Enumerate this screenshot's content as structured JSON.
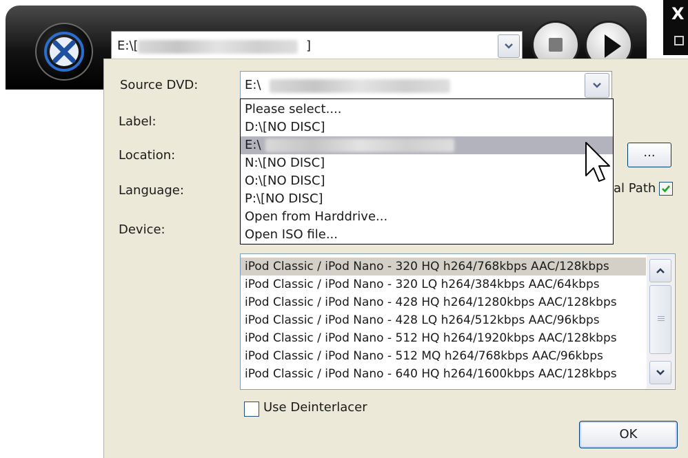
{
  "top_bar": {
    "source_path": "E:\\[",
    "source_path_end": "]"
  },
  "window": {
    "close_glyph": "X"
  },
  "dialog": {
    "labels": {
      "source_dvd": "Source DVD:",
      "label": "Label:",
      "location": "Location:",
      "language": "Language:",
      "device": "Device:"
    },
    "source_dvd_value": "E:\\",
    "source_options": [
      "Please select....",
      "D:\\[NO DISC]",
      "E:\\",
      "N:\\[NO DISC]",
      "O:\\[NO DISC]",
      "P:\\[NO DISC]",
      "Open from Harddrive...",
      "Open ISO file..."
    ],
    "browse_label": "...",
    "original_path_label": "al Path",
    "original_path_checked": true,
    "devices": [
      "iPod Classic / iPod Nano - 320 HQ h264/768kbps AAC/128kbps",
      "iPod Classic / iPod Nano - 320 LQ h264/384kbps AAC/64kbps",
      "iPod Classic / iPod Nano - 428 HQ h264/1280kbps AAC/128kbps",
      "iPod Classic / iPod Nano - 428 LQ h264/512kbps AAC/96kbps",
      "iPod Classic / iPod Nano - 512 HQ h264/1920kbps AAC/128kbps",
      "iPod Classic / iPod Nano - 512 MQ h264/768kbps AAC/96kbps",
      "iPod Classic / iPod Nano - 640 HQ h264/1600kbps AAC/128kbps"
    ],
    "use_deinterlacer_label": "Use Deinterlacer",
    "use_deinterlacer_checked": false,
    "ok_label": "OK"
  },
  "colors": {
    "dialog_bg": "#ece9d8",
    "dropdown_highlight": "#b3b3bd",
    "check_green": "#21a121"
  }
}
